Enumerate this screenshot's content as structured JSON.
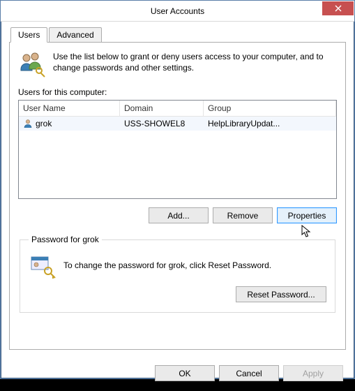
{
  "window": {
    "title": "User Accounts"
  },
  "tabs": {
    "users": "Users",
    "advanced": "Advanced"
  },
  "intro": "Use the list below to grant or deny users access to your computer, and to change passwords and other settings.",
  "list_label": "Users for this computer:",
  "columns": {
    "user": "User Name",
    "domain": "Domain",
    "group": "Group"
  },
  "rows": [
    {
      "user": "grok",
      "domain": "USS-SHOWEL8",
      "group": "HelpLibraryUpdat..."
    }
  ],
  "buttons": {
    "add": "Add...",
    "remove": "Remove",
    "properties": "Properties",
    "reset_pw": "Reset Password...",
    "ok": "OK",
    "cancel": "Cancel",
    "apply": "Apply"
  },
  "pw": {
    "legend": "Password for grok",
    "text": "To change the password for grok, click Reset Password."
  }
}
